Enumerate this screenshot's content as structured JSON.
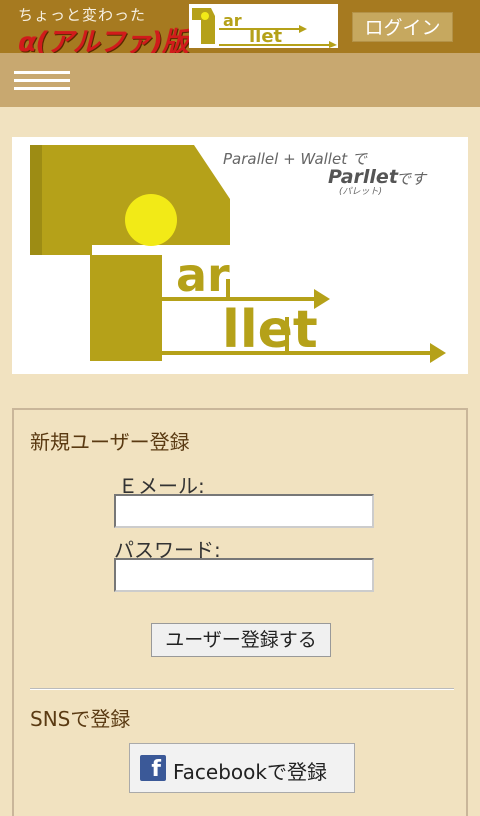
{
  "header": {
    "tagline": "ちょっと変わった",
    "brand_alpha": "α(アルファ)版",
    "login_label": "ログイン",
    "logo_small_text": "Parllet"
  },
  "nav": {
    "menu_icon": "hamburger-menu-icon"
  },
  "banner": {
    "line1": "Parallel + Wallet で",
    "brand": "Parllet",
    "line2": "です",
    "reading": "(パレット)",
    "logo_text": "Parllet",
    "logo_color": "#b5a119",
    "dot_color": "#f2ea17"
  },
  "register": {
    "title": "新規ユーザー登録",
    "email_label": "Ｅメール:",
    "email_value": "",
    "password_label": "パスワード:",
    "password_value": "",
    "submit_label": "ユーザー登録する"
  },
  "sns": {
    "title": "SNSで登録",
    "facebook_label": "Facebookで登録",
    "facebook_icon": "facebook-icon",
    "facebook_color": "#3b5998"
  }
}
